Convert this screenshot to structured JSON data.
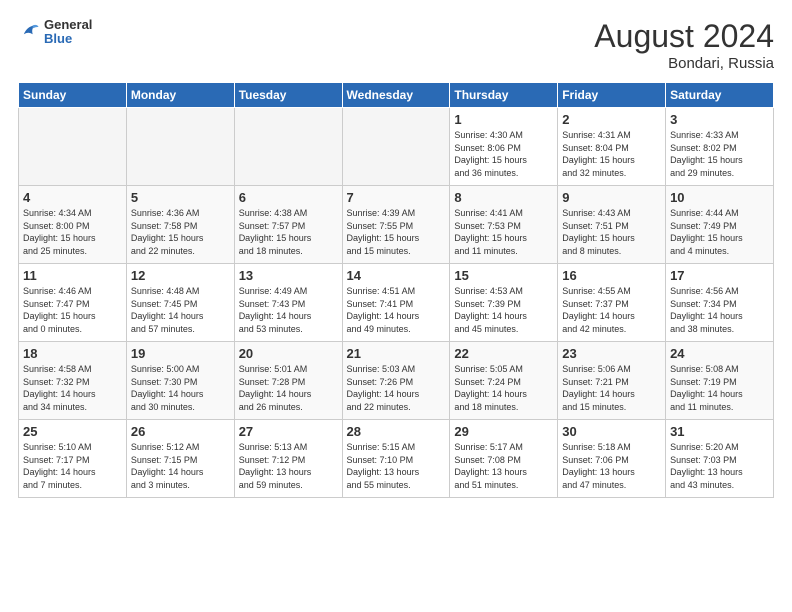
{
  "header": {
    "logo_general": "General",
    "logo_blue": "Blue",
    "month_title": "August 2024",
    "location": "Bondari, Russia"
  },
  "days_of_week": [
    "Sunday",
    "Monday",
    "Tuesday",
    "Wednesday",
    "Thursday",
    "Friday",
    "Saturday"
  ],
  "weeks": [
    [
      {
        "day": "",
        "info": ""
      },
      {
        "day": "",
        "info": ""
      },
      {
        "day": "",
        "info": ""
      },
      {
        "day": "",
        "info": ""
      },
      {
        "day": "1",
        "info": "Sunrise: 4:30 AM\nSunset: 8:06 PM\nDaylight: 15 hours\nand 36 minutes."
      },
      {
        "day": "2",
        "info": "Sunrise: 4:31 AM\nSunset: 8:04 PM\nDaylight: 15 hours\nand 32 minutes."
      },
      {
        "day": "3",
        "info": "Sunrise: 4:33 AM\nSunset: 8:02 PM\nDaylight: 15 hours\nand 29 minutes."
      }
    ],
    [
      {
        "day": "4",
        "info": "Sunrise: 4:34 AM\nSunset: 8:00 PM\nDaylight: 15 hours\nand 25 minutes."
      },
      {
        "day": "5",
        "info": "Sunrise: 4:36 AM\nSunset: 7:58 PM\nDaylight: 15 hours\nand 22 minutes."
      },
      {
        "day": "6",
        "info": "Sunrise: 4:38 AM\nSunset: 7:57 PM\nDaylight: 15 hours\nand 18 minutes."
      },
      {
        "day": "7",
        "info": "Sunrise: 4:39 AM\nSunset: 7:55 PM\nDaylight: 15 hours\nand 15 minutes."
      },
      {
        "day": "8",
        "info": "Sunrise: 4:41 AM\nSunset: 7:53 PM\nDaylight: 15 hours\nand 11 minutes."
      },
      {
        "day": "9",
        "info": "Sunrise: 4:43 AM\nSunset: 7:51 PM\nDaylight: 15 hours\nand 8 minutes."
      },
      {
        "day": "10",
        "info": "Sunrise: 4:44 AM\nSunset: 7:49 PM\nDaylight: 15 hours\nand 4 minutes."
      }
    ],
    [
      {
        "day": "11",
        "info": "Sunrise: 4:46 AM\nSunset: 7:47 PM\nDaylight: 15 hours\nand 0 minutes."
      },
      {
        "day": "12",
        "info": "Sunrise: 4:48 AM\nSunset: 7:45 PM\nDaylight: 14 hours\nand 57 minutes."
      },
      {
        "day": "13",
        "info": "Sunrise: 4:49 AM\nSunset: 7:43 PM\nDaylight: 14 hours\nand 53 minutes."
      },
      {
        "day": "14",
        "info": "Sunrise: 4:51 AM\nSunset: 7:41 PM\nDaylight: 14 hours\nand 49 minutes."
      },
      {
        "day": "15",
        "info": "Sunrise: 4:53 AM\nSunset: 7:39 PM\nDaylight: 14 hours\nand 45 minutes."
      },
      {
        "day": "16",
        "info": "Sunrise: 4:55 AM\nSunset: 7:37 PM\nDaylight: 14 hours\nand 42 minutes."
      },
      {
        "day": "17",
        "info": "Sunrise: 4:56 AM\nSunset: 7:34 PM\nDaylight: 14 hours\nand 38 minutes."
      }
    ],
    [
      {
        "day": "18",
        "info": "Sunrise: 4:58 AM\nSunset: 7:32 PM\nDaylight: 14 hours\nand 34 minutes."
      },
      {
        "day": "19",
        "info": "Sunrise: 5:00 AM\nSunset: 7:30 PM\nDaylight: 14 hours\nand 30 minutes."
      },
      {
        "day": "20",
        "info": "Sunrise: 5:01 AM\nSunset: 7:28 PM\nDaylight: 14 hours\nand 26 minutes."
      },
      {
        "day": "21",
        "info": "Sunrise: 5:03 AM\nSunset: 7:26 PM\nDaylight: 14 hours\nand 22 minutes."
      },
      {
        "day": "22",
        "info": "Sunrise: 5:05 AM\nSunset: 7:24 PM\nDaylight: 14 hours\nand 18 minutes."
      },
      {
        "day": "23",
        "info": "Sunrise: 5:06 AM\nSunset: 7:21 PM\nDaylight: 14 hours\nand 15 minutes."
      },
      {
        "day": "24",
        "info": "Sunrise: 5:08 AM\nSunset: 7:19 PM\nDaylight: 14 hours\nand 11 minutes."
      }
    ],
    [
      {
        "day": "25",
        "info": "Sunrise: 5:10 AM\nSunset: 7:17 PM\nDaylight: 14 hours\nand 7 minutes."
      },
      {
        "day": "26",
        "info": "Sunrise: 5:12 AM\nSunset: 7:15 PM\nDaylight: 14 hours\nand 3 minutes."
      },
      {
        "day": "27",
        "info": "Sunrise: 5:13 AM\nSunset: 7:12 PM\nDaylight: 13 hours\nand 59 minutes."
      },
      {
        "day": "28",
        "info": "Sunrise: 5:15 AM\nSunset: 7:10 PM\nDaylight: 13 hours\nand 55 minutes."
      },
      {
        "day": "29",
        "info": "Sunrise: 5:17 AM\nSunset: 7:08 PM\nDaylight: 13 hours\nand 51 minutes."
      },
      {
        "day": "30",
        "info": "Sunrise: 5:18 AM\nSunset: 7:06 PM\nDaylight: 13 hours\nand 47 minutes."
      },
      {
        "day": "31",
        "info": "Sunrise: 5:20 AM\nSunset: 7:03 PM\nDaylight: 13 hours\nand 43 minutes."
      }
    ]
  ]
}
